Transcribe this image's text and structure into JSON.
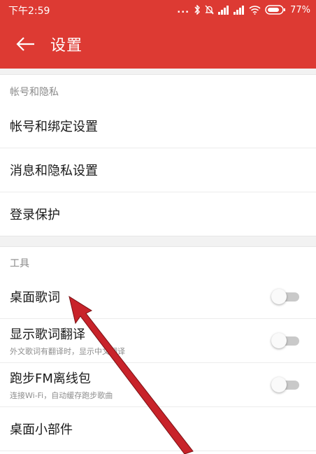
{
  "status_bar": {
    "time": "下午2:59",
    "dots": "...",
    "battery_percent": "77%"
  },
  "header": {
    "title": "设置",
    "back_icon": "arrow-left-icon"
  },
  "sections": [
    {
      "title": "帐号和隐私",
      "items": [
        {
          "title": "帐号和绑定设置"
        },
        {
          "title": "消息和隐私设置"
        },
        {
          "title": "登录保护"
        }
      ]
    },
    {
      "title": "工具",
      "items": [
        {
          "title": "桌面歌词",
          "toggle": false
        },
        {
          "title": "显示歌词翻译",
          "subtitle": "外文歌词有翻译时，显示中文翻译",
          "toggle": false
        },
        {
          "title": "跑步FM离线包",
          "subtitle": "连接Wi-Fi，自动缓存跑步歌曲",
          "toggle": false
        },
        {
          "title": "桌面小部件"
        }
      ]
    }
  ],
  "colors": {
    "accent": "#dd3a33",
    "annotation_arrow": "#c8232a"
  }
}
